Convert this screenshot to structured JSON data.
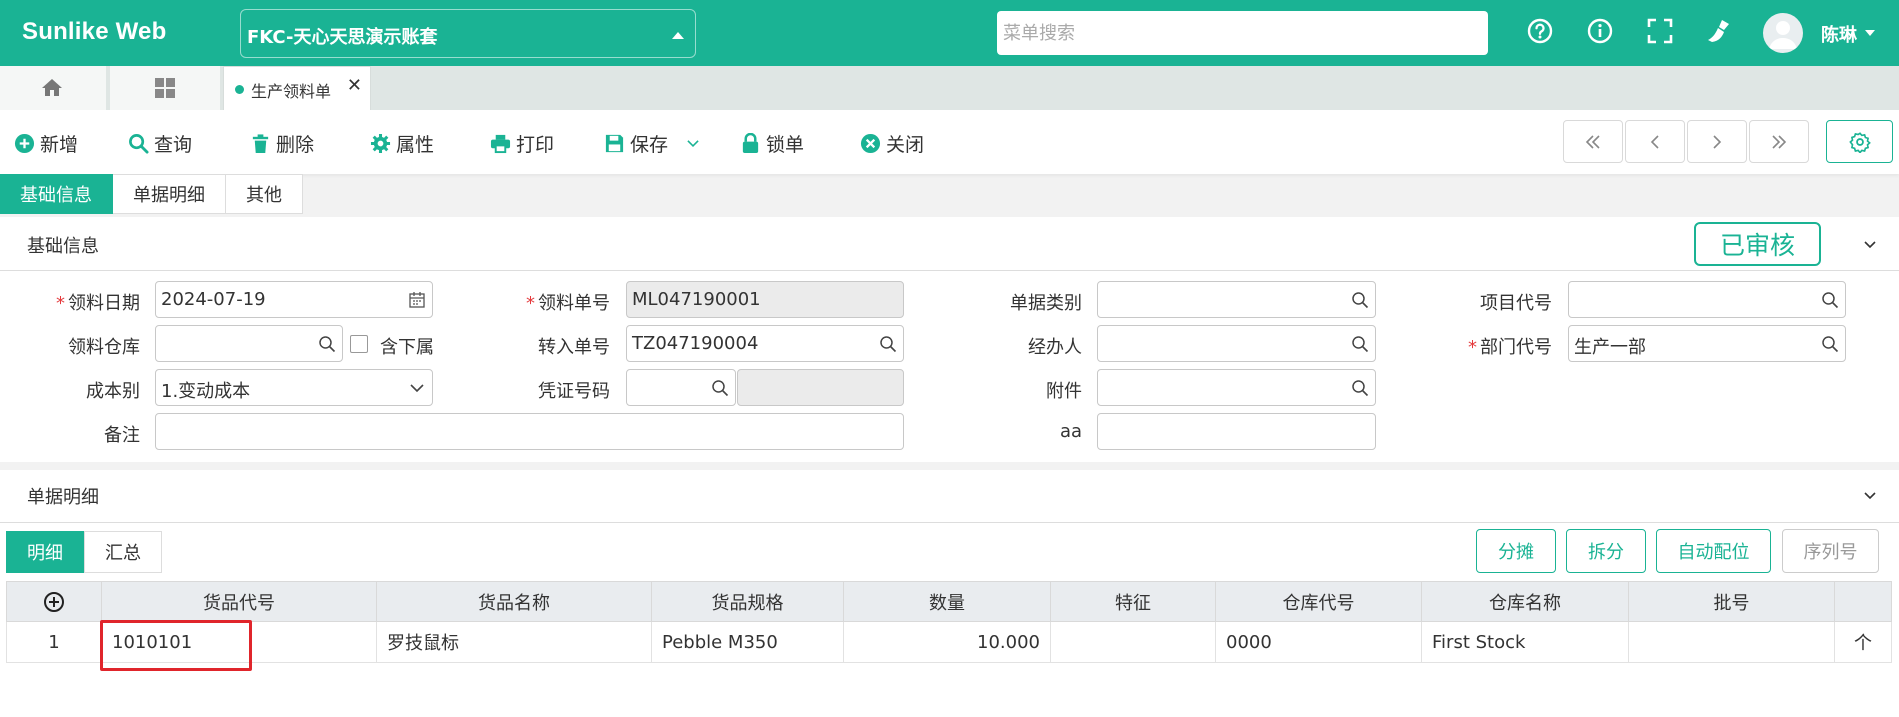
{
  "app": {
    "brand": "Sunlike Web",
    "account": "FKC-天心天思演示账套",
    "search_placeholder": "菜单搜索",
    "user_name": "陈琳"
  },
  "tabs": {
    "doc_tab": "生产领料单",
    "close_glyph": "✕"
  },
  "toolbar": {
    "add": "新增",
    "query": "查询",
    "delete": "删除",
    "properties": "属性",
    "print": "打印",
    "save": "保存",
    "lock": "锁单",
    "close": "关闭"
  },
  "section_tabs": [
    "基础信息",
    "单据明细",
    "其他"
  ],
  "basic": {
    "title": "基础信息",
    "status": "已审核",
    "fields": {
      "issue_date_label": "领料日期",
      "issue_date": "2024-07-19",
      "issue_no_label": "领料单号",
      "issue_no": "ML047190001",
      "doc_type_label": "单据类别",
      "doc_type": "",
      "project_label": "项目代号",
      "project": "",
      "warehouse_label": "领料仓库",
      "warehouse": "",
      "include_sub_label": "含下属",
      "transfer_no_label": "转入单号",
      "transfer_no": "TZ047190004",
      "handler_label": "经办人",
      "handler": "",
      "dept_label": "部门代号",
      "dept": "生产一部",
      "cost_label": "成本别",
      "cost": "1.变动成本",
      "voucher_label": "凭证号码",
      "voucher": "",
      "attachment_label": "附件",
      "attachment": "",
      "remark_label": "备注",
      "remark": "",
      "aa_label": "aa",
      "aa": ""
    }
  },
  "detail": {
    "title": "单据明细",
    "tabs": [
      "明细",
      "汇总"
    ],
    "actions": {
      "allocate": "分摊",
      "split": "拆分",
      "auto_match": "自动配位",
      "serial": "序列号"
    },
    "columns": [
      "货品代号",
      "货品名称",
      "货品规格",
      "数量",
      "特征",
      "仓库代号",
      "仓库名称",
      "批号"
    ],
    "rows": [
      {
        "no": "1",
        "item_code": "1010101",
        "item_name": "罗技鼠标",
        "spec": "Pebble M350",
        "qty": "10.000",
        "feature": "",
        "wh_code": "0000",
        "wh_name": "First Stock",
        "lot": "",
        "tail": "个"
      }
    ]
  },
  "colors": {
    "accent": "#1ab394",
    "highlight_box": "#e0252b"
  }
}
